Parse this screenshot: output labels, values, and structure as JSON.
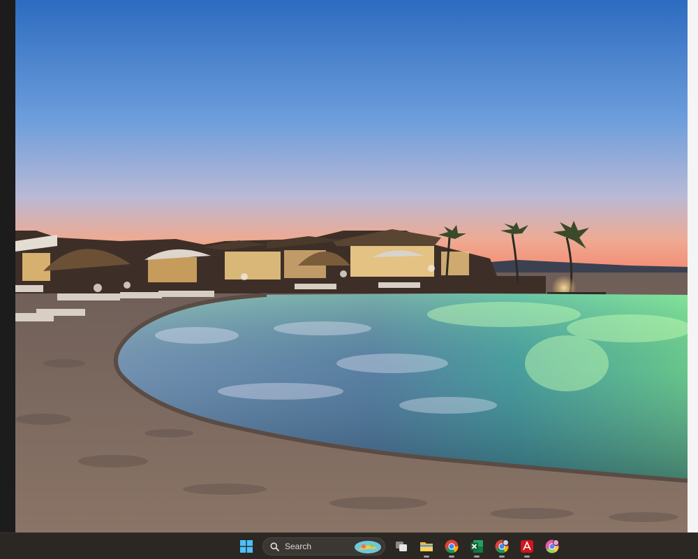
{
  "taskbar": {
    "search_label": "Search",
    "icons": {
      "start": "windows-start-icon",
      "search": "search-icon",
      "task_view": "task-view-icon",
      "explorer": "file-explorer-icon",
      "chrome": "chrome-icon",
      "excel": "excel-icon",
      "chrome_profile": "chrome-profile-icon",
      "acrobat": "acrobat-icon",
      "chrome_canary": "chrome-colorful-icon"
    }
  },
  "colors": {
    "sky_top": "#2e6fc0",
    "sky_horizon": "#f1a38a",
    "pool_green": "#7fe08a",
    "sand": "#7c6a5e",
    "taskbar": "#2b2723"
  }
}
